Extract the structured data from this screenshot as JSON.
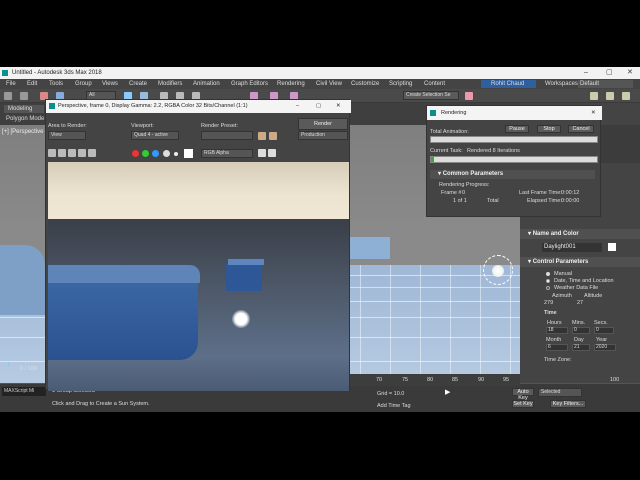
{
  "window": {
    "title": "Untitled - Autodesk 3ds Max 2018"
  },
  "menu": [
    "File",
    "Edit",
    "Tools",
    "Group",
    "Views",
    "Create",
    "Modifiers",
    "Animation",
    "Graph Editors",
    "Rendering",
    "Civil View",
    "Customize",
    "Scripting",
    "Content"
  ],
  "toolbar": {
    "all_filter": "All",
    "create_selection_set": "Create Selection Se",
    "user": "Rohit Chaud",
    "workspaces_label": "Workspaces:",
    "workspace": "Default"
  },
  "left_tabs": {
    "modeling": "Modeling",
    "polygon": "Polygon Mode"
  },
  "viewport": {
    "label": "[+] [Perspective",
    "frame_counter": "0 / 100"
  },
  "frame_window": {
    "title": "Perspective, frame 0, Display Gamma: 2.2, RGBA Color 32 Bits/Channel (1:1)",
    "area_label": "Area to Render:",
    "area_value": "View",
    "viewport_label": "Viewport:",
    "viewport_value": "Quad 4 - active",
    "preset_label": "Render Preset:",
    "preset_value": "",
    "render_button": "Render",
    "production_value": "Production",
    "channel_value": "RGB Alpha"
  },
  "render_window": {
    "title": "Rendering",
    "total_animation_label": "Total Animation:",
    "pause": "Pause",
    "stop": "Stop",
    "cancel": "Cancel",
    "current_task_label": "Current Task:",
    "current_task_value": "Rendered 8 Iterations",
    "section": "Common Parameters",
    "progress_label": "Rendering Progress:",
    "frame_label": "Frame #",
    "frame_value": "0",
    "last_frame_label": "Last Frame Time:",
    "last_frame_value": "0:00:12",
    "of_label": "1 of 1",
    "total_label": "Total",
    "elapsed_label": "Elapsed Time:",
    "elapsed_value": "0:00:00"
  },
  "right_panel": {
    "name_color_header": "Name and Color",
    "object_name": "Daylight001",
    "control_header": "Control Parameters",
    "manual": "Manual",
    "date_time_location": "Date, Time and Location",
    "weather_file": "Weather Data File",
    "azimuth_label": "Azimuth",
    "altitude_label": "Altitude",
    "azimuth_value": "279",
    "altitude_value": "27",
    "time_header": "Time",
    "hours_label": "Hours",
    "mins_label": "Mins.",
    "secs_label": "Secs.",
    "hours_value": "18",
    "mins_value": "0",
    "secs_value": "0",
    "month_label": "Month",
    "day_label": "Day",
    "year_label": "Year",
    "month_value": "6",
    "day_value": "21",
    "year_value": "2020",
    "timezone_label": "Time Zone:"
  },
  "status": {
    "maxscript": "MAXScript Mi",
    "selected": "1 Group Selected",
    "hint": "Click and Drag to Create a Sun System.",
    "grid": "Grid = 10.0",
    "add_time_tag": "Add Time Tag",
    "auto_key": "Auto Key",
    "selected_dropdown": "Selected",
    "set_key": "Set Key",
    "key_filters": "Key Filters...",
    "timeline_labels": [
      "70",
      "75",
      "80",
      "85",
      "90",
      "95",
      "100"
    ]
  }
}
